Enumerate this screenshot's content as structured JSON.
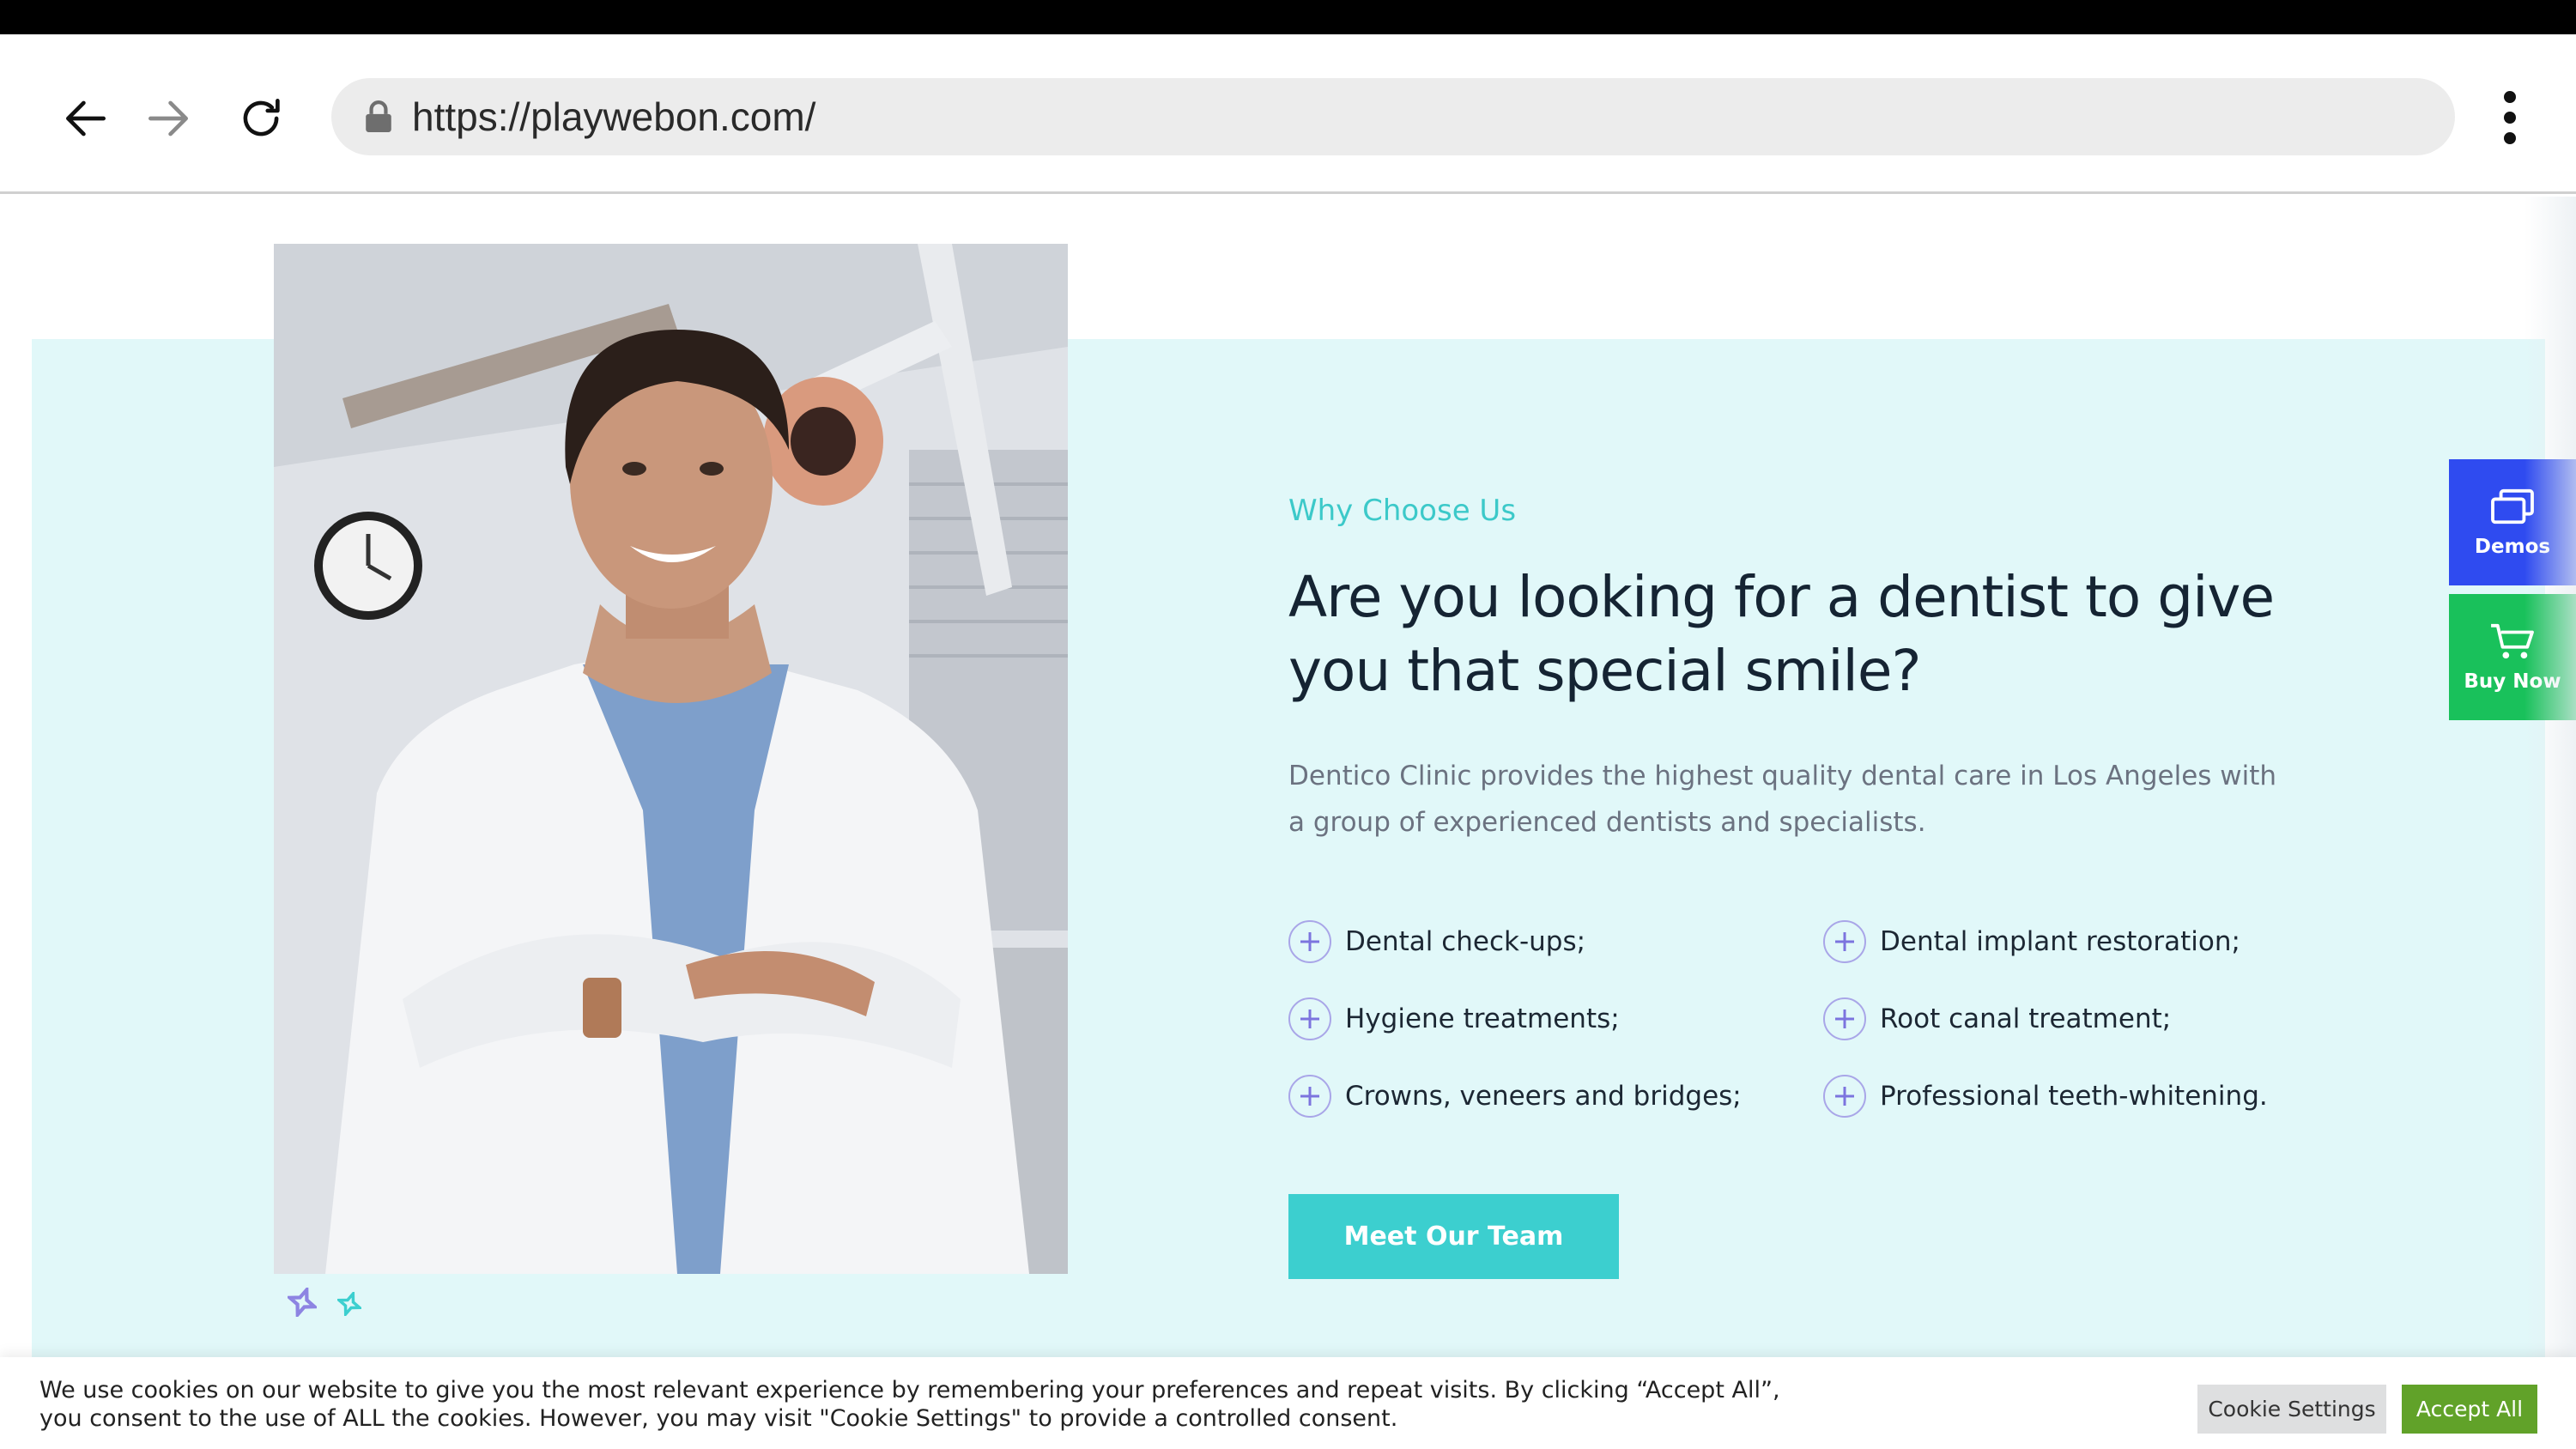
{
  "browser": {
    "url": "https://playwebon.com/",
    "icons": [
      "back-arrow-icon",
      "forward-arrow-icon",
      "reload-icon",
      "lock-icon",
      "more-vert-icon"
    ]
  },
  "section": {
    "eyebrow": "Why Choose Us",
    "headline": "Are you looking for a dentist to give you that special smile?",
    "description": "Dentico Clinic provides the highest quality dental care in Los Angeles with a group of experienced dentists and specialists.",
    "features_left": [
      "Dental check-ups;",
      "Hygiene treatments;",
      "Crowns, veneers and bridges;"
    ],
    "features_right": [
      "Dental implant restoration;",
      "Root canal treatment;",
      "Professional teeth-whitening."
    ],
    "cta_label": "Meet Our Team"
  },
  "side_widgets": {
    "demos_label": "Demos",
    "buy_label": "Buy Now"
  },
  "cookie": {
    "text": "We use cookies on our website to give you the most relevant experience by remembering your preferences and repeat visits. By clicking “Accept All”, you consent to the use of ALL the cookies. However, you may visit \"Cookie Settings\" to provide a controlled consent.",
    "settings_label": "Cookie Settings",
    "accept_label": "Accept All"
  },
  "colors": {
    "accent_teal": "#3ccfcf",
    "band_background": "#e1f8f9",
    "plus_icon": "#7c74de",
    "demos_blue": "#2f4bf0",
    "buy_green": "#19c15b",
    "accept_green": "#61a229"
  }
}
